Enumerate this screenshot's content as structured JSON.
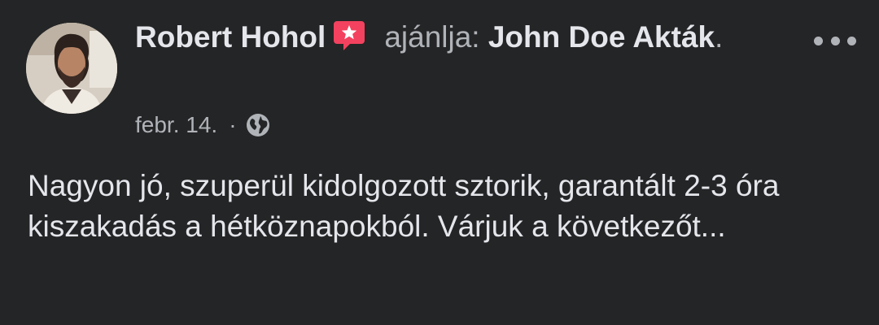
{
  "post": {
    "author": "Robert Hohol",
    "action": "ajánlja:",
    "target": "John Doe Akták",
    "period": ".",
    "date": "febr. 14.",
    "separator": "·",
    "privacy_icon": "globe-icon",
    "body": "Nagyon jó, szuperül kidolgozott sztorik, garantált 2-3 óra kiszakadás a hétköznapokból. Várjuk a következőt..."
  },
  "icons": {
    "recommendation": "recommend-icon",
    "more": "more-options-icon"
  },
  "colors": {
    "background": "#242526",
    "primary_text": "#e4e6eb",
    "secondary_text": "#b0b3b8",
    "recommend_red": "#f3425f"
  }
}
